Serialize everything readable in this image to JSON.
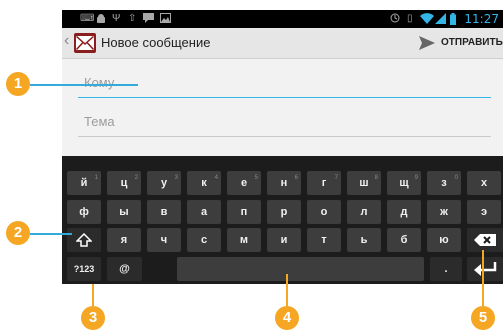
{
  "statusbar": {
    "time": "11:27",
    "icons": [
      "keyboard-icon",
      "android-icon",
      "usb-icon",
      "upload-icon",
      "chat-icon",
      "image-icon",
      "clock-icon",
      "vibrate-icon",
      "wifi-icon",
      "signal-icon",
      "battery-icon"
    ]
  },
  "actionbar": {
    "title": "Новое сообщение",
    "send_label": "ОТПРАВИТЬ",
    "back_caret": "‹"
  },
  "compose": {
    "to_placeholder": "Кому",
    "subject_placeholder": "Тема"
  },
  "keyboard": {
    "row1": [
      {
        "label": "й",
        "hint": "1"
      },
      {
        "label": "ц",
        "hint": "2"
      },
      {
        "label": "у",
        "hint": "3"
      },
      {
        "label": "к",
        "hint": "4"
      },
      {
        "label": "е",
        "hint": "5"
      },
      {
        "label": "н",
        "hint": "6"
      },
      {
        "label": "г",
        "hint": "7"
      },
      {
        "label": "ш",
        "hint": "8"
      },
      {
        "label": "щ",
        "hint": "9"
      },
      {
        "label": "з",
        "hint": "0"
      },
      {
        "label": "х",
        "hint": ""
      }
    ],
    "row2": [
      "ф",
      "ы",
      "в",
      "а",
      "п",
      "р",
      "о",
      "л",
      "д",
      "ж",
      "э"
    ],
    "row3": [
      "я",
      "ч",
      "с",
      "м",
      "и",
      "т",
      "ь",
      "б",
      "ю"
    ],
    "row4": {
      "symbols_label": "?123",
      "at_label": "@",
      "dot_label": "."
    }
  },
  "callouts": [
    "1",
    "2",
    "3",
    "4",
    "5"
  ],
  "colors": {
    "accent": "#33b5e5",
    "callout": "#f5a623",
    "leader": "#33a9dc",
    "app_icon": "#8a1e1e"
  }
}
